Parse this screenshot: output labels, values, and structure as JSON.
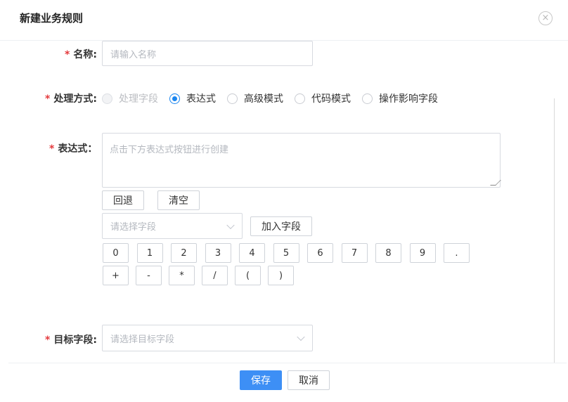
{
  "dialog": {
    "title": "新建业务规则",
    "close_glyph": "×"
  },
  "form": {
    "required_mark": "*",
    "name": {
      "label": "名称:",
      "placeholder": "请输入名称"
    },
    "method": {
      "label": "处理方式:",
      "options": [
        {
          "label": "处理字段",
          "state": "disabled"
        },
        {
          "label": "表达式",
          "state": "checked"
        },
        {
          "label": "高级模式",
          "state": "unchecked"
        },
        {
          "label": "代码模式",
          "state": "unchecked"
        },
        {
          "label": "操作影响字段",
          "state": "unchecked"
        }
      ]
    },
    "expression": {
      "label": "表达式：",
      "placeholder": "点击下方表达式按钮进行创建",
      "back_label": "回退",
      "clear_label": "清空",
      "field_select_placeholder": "请选择字段",
      "add_field_label": "加入字段",
      "keys_row1": [
        "0",
        "1",
        "2",
        "3",
        "4",
        "5",
        "6",
        "7",
        "8",
        "9",
        "."
      ],
      "keys_row2": [
        "+",
        "-",
        "*",
        "/",
        "(",
        ")"
      ]
    },
    "target": {
      "label": "目标字段:",
      "placeholder": "请选择目标字段"
    }
  },
  "footer": {
    "save_label": "保存",
    "cancel_label": "取消"
  },
  "colors": {
    "primary": "#3d8ff5",
    "required": "#e4393c",
    "radio_checked": "#1a86f0"
  }
}
